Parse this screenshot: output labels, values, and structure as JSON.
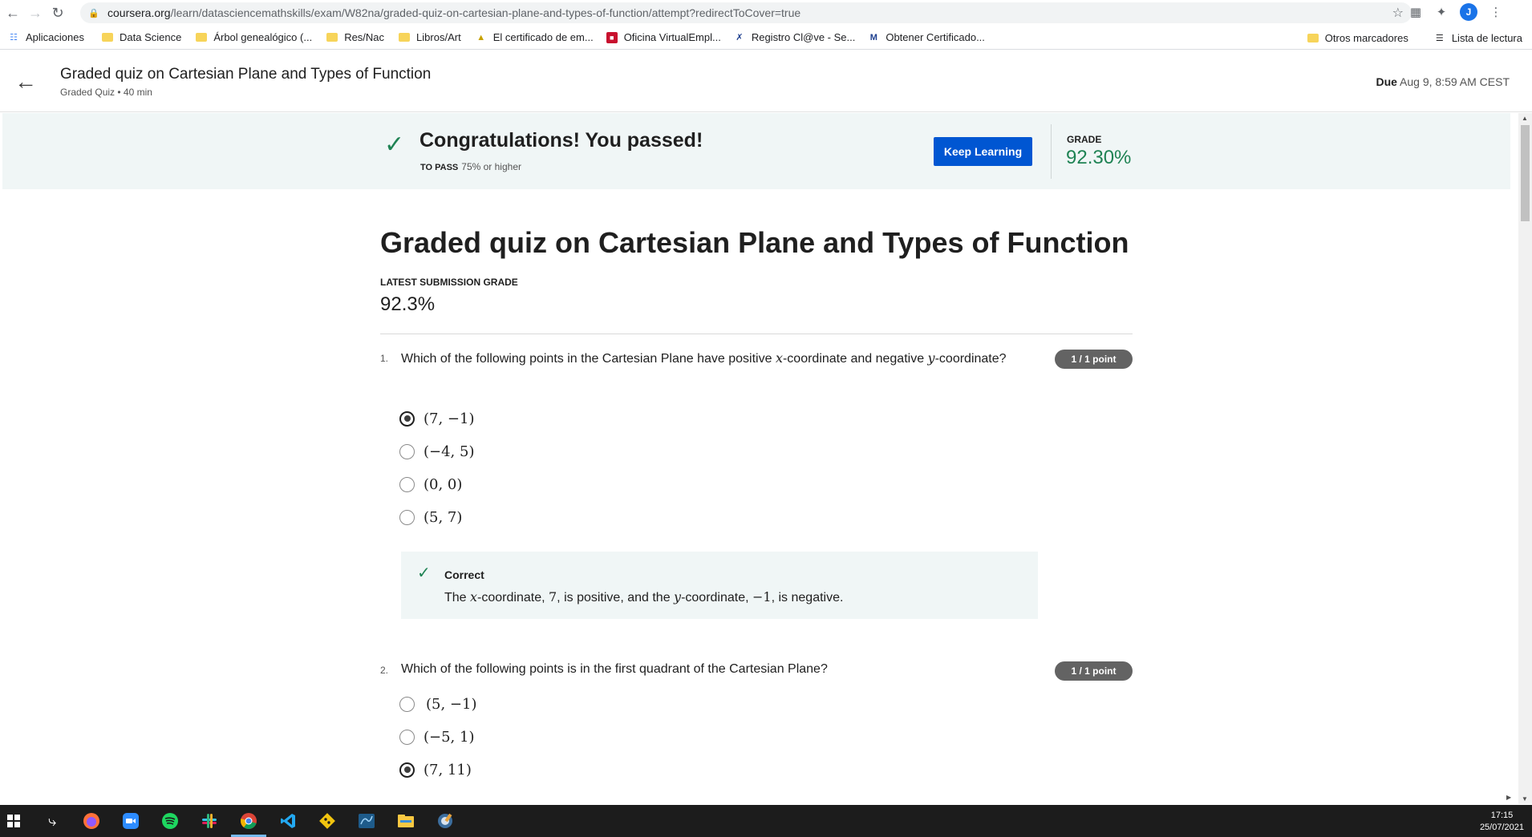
{
  "browser": {
    "url_host": "coursera.org",
    "url_path": "/learn/datasciencemathskills/exam/W82na/graded-quiz-on-cartesian-plane-and-types-of-function/attempt?redirectToCover=true",
    "avatar_letter": "J",
    "bookmarks": [
      "Aplicaciones",
      "Data Science",
      "Árbol genealógico (...",
      "Res/Nac",
      "Libros/Art",
      "El certificado de em...",
      "Oficina VirtualEmpl...",
      "Registro Cl@ve - Se...",
      "Obtener Certificado..."
    ],
    "bookmarks_right": [
      "Otros marcadores",
      "Lista de lectura"
    ]
  },
  "header": {
    "title": "Graded quiz on Cartesian Plane and Types of Function",
    "subtitle": "Graded Quiz • 40 min",
    "due_label": "Due",
    "due_value": "Aug 9, 8:59 AM CEST"
  },
  "banner": {
    "message": "Congratulations! You passed!",
    "to_pass_label": "TO PASS",
    "to_pass_value": "75% or higher",
    "button": "Keep Learning",
    "grade_label": "GRADE",
    "grade_value": "92.30%"
  },
  "main": {
    "title": "Graded quiz on Cartesian Plane and Types of Function",
    "latest_label": "LATEST SUBMISSION GRADE",
    "latest_value": "92.3%"
  },
  "questions": [
    {
      "num": "1.",
      "text_parts": [
        "Which of the following points in the Cartesian Plane have positive ",
        "x",
        "-coordinate and negative ",
        "y",
        "-coordinate?"
      ],
      "points": "1 / 1 point",
      "options": [
        "(7, −1)",
        "(−4, 5)",
        "(0, 0)",
        "(5, 7)"
      ],
      "selected": 0,
      "feedback": {
        "title": "Correct",
        "parts": [
          "The ",
          "x",
          "-coordinate, ",
          "7",
          ", is positive, and the ",
          "y",
          "-coordinate, ",
          "−1",
          ", is negative."
        ]
      }
    },
    {
      "num": "2.",
      "text": "Which of the following points is in the first quadrant of the Cartesian Plane?",
      "points": "1 / 1 point",
      "options": [
        "(5, −1)",
        "(−5, 1)",
        "(7, 11)"
      ],
      "selected": 2
    }
  ],
  "taskbar": {
    "time": "17:15",
    "date": "25/07/2021"
  },
  "colors": {
    "accent": "#0056d2",
    "success": "#1f8354",
    "banner_bg": "#f0f6f6"
  }
}
